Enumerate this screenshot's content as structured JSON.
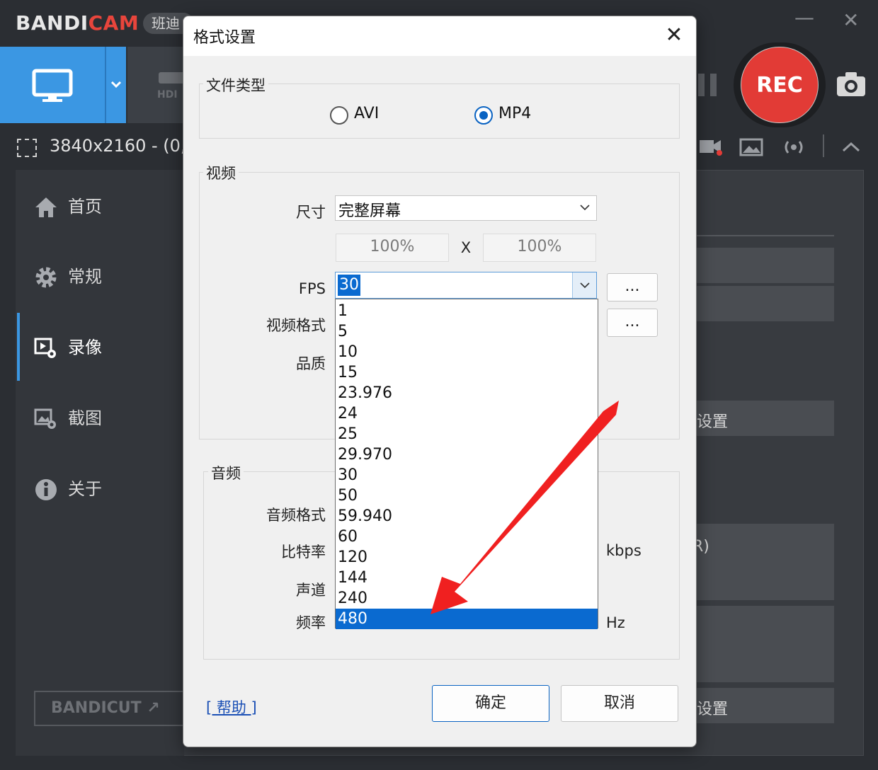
{
  "app": {
    "logo_main": "BANDI",
    "logo_accent": "CAM",
    "logo_cn": "班迪",
    "rec_label": "REC",
    "resolution_text": "3840x2160 - (0, 0",
    "bandicut_main": "BANDI",
    "bandicut_accent": "CUT",
    "bandicut_suffix": "↗",
    "sidebar": {
      "items": [
        {
          "label": "首页",
          "icon": "home-icon"
        },
        {
          "label": "常规",
          "icon": "gear-icon"
        },
        {
          "label": "录像",
          "icon": "video-settings-icon"
        },
        {
          "label": "截图",
          "icon": "image-settings-icon"
        },
        {
          "label": "关于",
          "icon": "info-icon"
        }
      ],
      "active_index": 2
    },
    "right_panel": {
      "settings_1": "设置",
      "paren_fragment": "R)",
      "settings_2": "设置"
    }
  },
  "dialog": {
    "title": "格式设置",
    "close_glyph": "✕",
    "file_type": {
      "label": "文件类型",
      "options": [
        "AVI",
        "MP4"
      ],
      "selected": "MP4"
    },
    "video": {
      "label": "视频",
      "size_label": "尺寸",
      "size_value": "完整屏幕",
      "width_pct": "100%",
      "x_sep": "X",
      "height_pct": "100%",
      "fps_label": "FPS",
      "fps_value": "30",
      "format_label": "视频格式",
      "quality_label": "品质",
      "more_button": "...",
      "fps_options": [
        "1",
        "5",
        "10",
        "15",
        "23.976",
        "24",
        "25",
        "29.970",
        "30",
        "50",
        "59.940",
        "60",
        "120",
        "144",
        "240",
        "480"
      ],
      "fps_highlighted": "480"
    },
    "audio": {
      "label": "音频",
      "format_label": "音频格式",
      "bitrate_label": "比特率",
      "bitrate_unit": "kbps",
      "channel_label": "声道",
      "freq_label": "频率",
      "freq_unit": "Hz"
    },
    "help_text": "[ 帮助 ]",
    "ok_label": "确定",
    "cancel_label": "取消"
  },
  "colors": {
    "accent_blue": "#3b97e3",
    "rec_red": "#e23b36",
    "selection_blue": "#0a6ad0",
    "annotation_red": "#f02020"
  }
}
